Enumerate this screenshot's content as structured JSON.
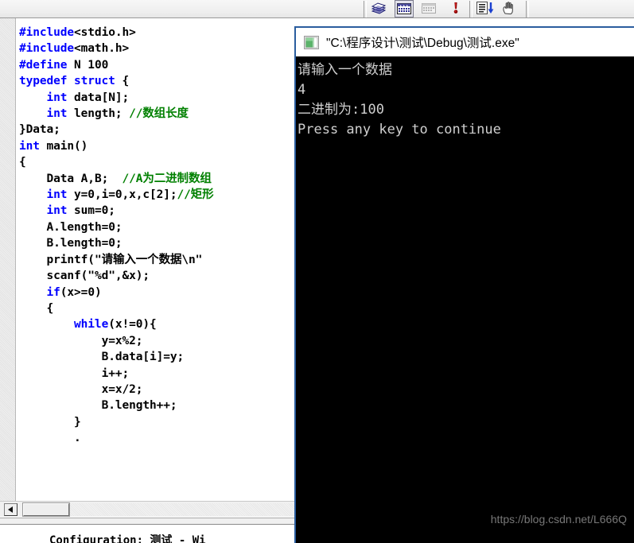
{
  "toolbar": {
    "icons": [
      {
        "name": "compile-icon",
        "label": "Compile",
        "pressed": false
      },
      {
        "name": "build-icon",
        "label": "Build",
        "pressed": true
      },
      {
        "name": "stop-build-icon",
        "label": "Stop Build",
        "pressed": false
      },
      {
        "name": "execute-program-icon",
        "label": "Execute Program",
        "pressed": false
      },
      {
        "name": "go-debug-icon",
        "label": "Go",
        "pressed": false
      },
      {
        "name": "insert-breakpoint-icon",
        "label": "Insert/Remove Breakpoint",
        "pressed": false
      }
    ]
  },
  "editor": {
    "title": "",
    "code_lines": [
      {
        "indent": 0,
        "tokens": [
          {
            "t": "#include",
            "c": "pp"
          },
          {
            "t": "<stdio.h>",
            "c": ""
          }
        ]
      },
      {
        "indent": 0,
        "tokens": [
          {
            "t": "#include",
            "c": "pp"
          },
          {
            "t": "<math.h>",
            "c": ""
          }
        ]
      },
      {
        "indent": 0,
        "tokens": [
          {
            "t": "#define",
            "c": "pp"
          },
          {
            "t": " N 100",
            "c": ""
          }
        ]
      },
      {
        "indent": 0,
        "tokens": [
          {
            "t": "typedef struct",
            "c": "k"
          },
          {
            "t": " {",
            "c": ""
          }
        ]
      },
      {
        "indent": 1,
        "tokens": [
          {
            "t": "int",
            "c": "k"
          },
          {
            "t": " data[N];",
            "c": ""
          }
        ]
      },
      {
        "indent": 1,
        "tokens": [
          {
            "t": "int",
            "c": "k"
          },
          {
            "t": " length; ",
            "c": ""
          },
          {
            "t": "//数组长度",
            "c": "cm"
          }
        ]
      },
      {
        "indent": 0,
        "tokens": [
          {
            "t": "}Data;",
            "c": ""
          }
        ]
      },
      {
        "indent": 0,
        "tokens": [
          {
            "t": "int",
            "c": "k"
          },
          {
            "t": " main()",
            "c": ""
          }
        ]
      },
      {
        "indent": 0,
        "tokens": [
          {
            "t": "{",
            "c": ""
          }
        ]
      },
      {
        "indent": 1,
        "tokens": [
          {
            "t": "Data A,B;  ",
            "c": ""
          },
          {
            "t": "//A为二进制数组",
            "c": "cm"
          }
        ]
      },
      {
        "indent": 1,
        "tokens": [
          {
            "t": "int",
            "c": "k"
          },
          {
            "t": " y=0,i=0,x,c[2];",
            "c": ""
          },
          {
            "t": "//矩形",
            "c": "cm"
          }
        ]
      },
      {
        "indent": 1,
        "tokens": [
          {
            "t": "int",
            "c": "k"
          },
          {
            "t": " sum=0;",
            "c": ""
          }
        ]
      },
      {
        "indent": 1,
        "tokens": [
          {
            "t": "A.length=0;",
            "c": ""
          }
        ]
      },
      {
        "indent": 1,
        "tokens": [
          {
            "t": "B.length=0;",
            "c": ""
          }
        ]
      },
      {
        "indent": 1,
        "tokens": [
          {
            "t": "printf(\"请输入一个数据\\n\"",
            "c": ""
          }
        ]
      },
      {
        "indent": 1,
        "tokens": [
          {
            "t": "scanf(\"%d\",&x);",
            "c": ""
          }
        ]
      },
      {
        "indent": 1,
        "tokens": [
          {
            "t": "if",
            "c": "k"
          },
          {
            "t": "(x>=0)",
            "c": ""
          }
        ]
      },
      {
        "indent": 1,
        "tokens": [
          {
            "t": "{",
            "c": ""
          }
        ]
      },
      {
        "indent": 2,
        "tokens": [
          {
            "t": "while",
            "c": "k"
          },
          {
            "t": "(x!=0){",
            "c": ""
          }
        ]
      },
      {
        "indent": 3,
        "tokens": [
          {
            "t": "y=x%2;",
            "c": ""
          }
        ]
      },
      {
        "indent": 3,
        "tokens": [
          {
            "t": "B.data[i]=y;",
            "c": ""
          }
        ]
      },
      {
        "indent": 3,
        "tokens": [
          {
            "t": "i++;",
            "c": ""
          }
        ]
      },
      {
        "indent": 3,
        "tokens": [
          {
            "t": "x=x/2;",
            "c": ""
          }
        ]
      },
      {
        "indent": 3,
        "tokens": [
          {
            "t": "B.length++;",
            "c": ""
          }
        ]
      },
      {
        "indent": 2,
        "tokens": [
          {
            "t": "}",
            "c": ""
          }
        ]
      },
      {
        "indent": 2,
        "tokens": [
          {
            "t": ".",
            "c": ""
          }
        ]
      }
    ],
    "scrollbar": {
      "left_arrow_glyph": "◄"
    }
  },
  "output_pane": {
    "line": "Configuration: 测试 - Wi"
  },
  "console": {
    "title": "\"C:\\程序设计\\测试\\Debug\\测试.exe\"",
    "icon_name": "console-app-icon",
    "lines": [
      "请输入一个数据",
      "4",
      "二进制为:100",
      "Press any key to continue"
    ],
    "background": "#000000",
    "foreground": "#cfcfcf",
    "border_color": "#2a5d9e"
  },
  "watermark": {
    "text": "https://blog.csdn.net/L666Q"
  }
}
